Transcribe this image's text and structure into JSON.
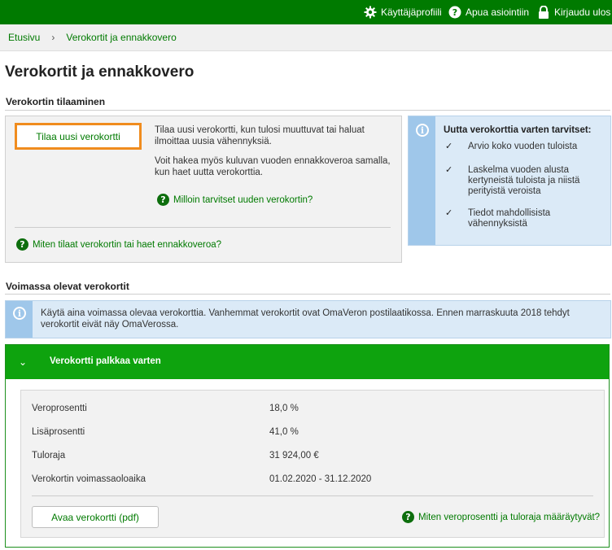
{
  "topbar": {
    "profile": "Käyttäjäprofiili",
    "help": "Apua asiointiin",
    "logout": "Kirjaudu ulos"
  },
  "breadcrumb": {
    "home": "Etusivu",
    "separator": "›",
    "current": "Verokortit ja ennakkovero"
  },
  "page": {
    "title": "Verokortit ja ennakkovero"
  },
  "ordering": {
    "section_title": "Verokortin tilaaminen",
    "order_button": "Tilaa uusi verokortti",
    "desc1": "Tilaa uusi verokortti, kun tulosi muuttuvat tai haluat ilmoittaa uusia vähennyksiä.",
    "desc2": "Voit hakea myös kuluvan vuoden ennakkoveroa samalla, kun haet uutta verokorttia.",
    "when_link": "Milloin tarvitset uuden verokortin?",
    "how_link": "Miten tilaat verokortin tai haet ennakkoveroa?"
  },
  "needs": {
    "title": "Uutta verokorttia varten tarvitset:",
    "check": "✓",
    "items": [
      "Arvio koko vuoden tuloista",
      "Laskelma vuoden alusta kertyneistä tuloista ja niistä perityistä veroista",
      "Tiedot mahdollisista vähennyksistä"
    ]
  },
  "valid": {
    "section_title": "Voimassa olevat verokortit",
    "notice": "Käytä aina voimassa olevaa verokorttia. Vanhemmat verokortit ovat OmaVeron postilaatikossa. Ennen marraskuuta 2018 tehdyt verokortit eivät näy OmaVerossa."
  },
  "card": {
    "title": "Verokortti palkkaa varten",
    "rows": [
      {
        "label": "Veroprosentti",
        "value": "18,0 %"
      },
      {
        "label": "Lisäprosentti",
        "value": "41,0 %"
      },
      {
        "label": "Tuloraja",
        "value": "31 924,00 €"
      },
      {
        "label": "Verokortin voimassaoloaika",
        "value": "01.02.2020 - 31.12.2020"
      }
    ],
    "pdf_button": "Avaa verokortti (pdf)",
    "rates_link": "Miten veroprosentti ja tuloraja määräytyvät?"
  },
  "icons": {
    "question": "?",
    "info": "i",
    "chevron": "⌄"
  },
  "colors": {
    "brand_green": "#007a00",
    "accent_orange": "#f08c1e",
    "info_blue": "#9fc7ea"
  }
}
